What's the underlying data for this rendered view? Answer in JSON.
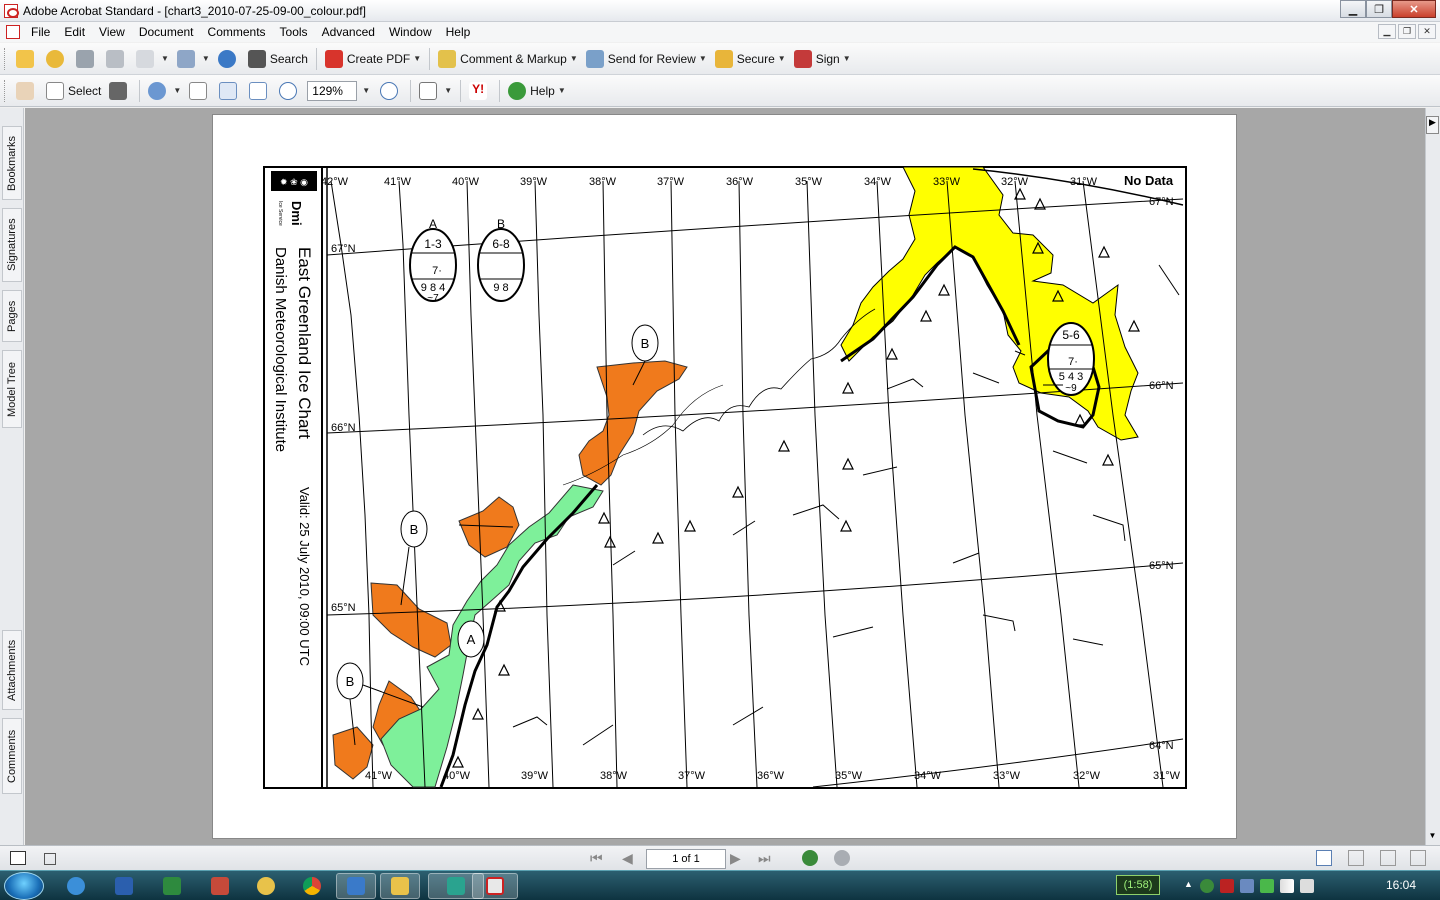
{
  "window": {
    "title": "Adobe Acrobat Standard - [chart3_2010-07-25-09-00_colour.pdf]"
  },
  "menu": [
    "File",
    "Edit",
    "View",
    "Document",
    "Comments",
    "Tools",
    "Advanced",
    "Window",
    "Help"
  ],
  "toolbar1": {
    "search": "Search",
    "create_pdf": "Create PDF",
    "comment_markup": "Comment & Markup",
    "send_review": "Send for Review",
    "secure": "Secure",
    "sign": "Sign"
  },
  "toolbar2": {
    "select": "Select",
    "zoom": "129%",
    "help": "Help"
  },
  "side_tabs": [
    "Bookmarks",
    "Signatures",
    "Pages",
    "Model Tree",
    "Attachments",
    "Comments"
  ],
  "document": {
    "logo_text": "Dmi",
    "logo_sub": "Ice Service",
    "chart_title": "East Greenland Ice Chart",
    "institute": "Danish Meteorological Institute",
    "valid": "Valid: 25 July 2010, 09:00 UTC",
    "no_data": "No Data",
    "lon_top": [
      "42°W",
      "41°W",
      "40°W",
      "39°W",
      "38°W",
      "37°W",
      "36°W",
      "35°W",
      "34°W",
      "33°W",
      "32°W",
      "31°W"
    ],
    "lon_bottom": [
      "41°W",
      "40°W",
      "39°W",
      "38°W",
      "37°W",
      "36°W",
      "35°W",
      "34°W",
      "33°W",
      "32°W",
      "31°W"
    ],
    "lat_left": [
      "67°N",
      "66°N",
      "65°N"
    ],
    "lat_right": [
      "67°N",
      "66°N",
      "65°N",
      "64°N"
    ],
    "egg_a": {
      "letter": "A",
      "top": "1-3",
      "mid": "7·",
      "bot": "9 8 4",
      "tail": "~7"
    },
    "egg_b": {
      "letter": "B",
      "top": "6-8",
      "bot": "9 8"
    },
    "egg_c": {
      "top": "5-6",
      "mid": "7·",
      "bot": "5 4 3",
      "tail": "~9"
    },
    "region_labels": [
      "B",
      "B",
      "A",
      "B"
    ]
  },
  "status": {
    "page": "1 of 1"
  },
  "taskbar": {
    "battery": "(1:58)",
    "clock": "16:04"
  },
  "colors": {
    "yellow": "#ffff00",
    "orange": "#f07a1c",
    "green": "#7ef09a"
  }
}
